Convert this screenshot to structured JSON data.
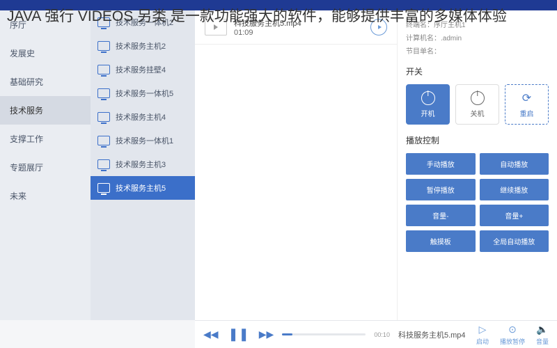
{
  "overlay": "JAVA 强行 VIDEOS 另类 是一款功能强大的软件，能够提供丰富的多媒体体验",
  "nav": {
    "items": [
      {
        "label": "序厅"
      },
      {
        "label": "发展史"
      },
      {
        "label": "基础研究"
      },
      {
        "label": "技术服务"
      },
      {
        "label": "支撑工作"
      },
      {
        "label": "专题展厅"
      },
      {
        "label": "未来"
      }
    ],
    "active": 3
  },
  "hosts": {
    "items": [
      {
        "label": "技术服务一体机2"
      },
      {
        "label": "技术服务主机2"
      },
      {
        "label": "技术服务挂壁4"
      },
      {
        "label": "技术服务一体机5"
      },
      {
        "label": "技术服务主机4"
      },
      {
        "label": "技术服务一体机1"
      },
      {
        "label": "技术服务主机3"
      },
      {
        "label": "技术服务主机5"
      }
    ],
    "active": 7
  },
  "video": {
    "title": "科技服务主机5.mp4",
    "duration": "01:09"
  },
  "meta": {
    "terminal_label": "终端名：",
    "terminal_value": "序厅主机1",
    "computer_label": "计算机名：",
    "computer_value": ".admin",
    "program_label": "节目单名："
  },
  "power": {
    "section": "开关",
    "on": "开机",
    "off": "关机",
    "restart": "重启"
  },
  "playback": {
    "section": "播放控制",
    "buttons": [
      "手动播放",
      "自动播放",
      "暂停播放",
      "继续播放",
      "音量-",
      "音量+",
      "触摸板",
      "全局自动播放"
    ]
  },
  "player": {
    "time": "00:10",
    "now_playing": "科技服务主机5.mp4",
    "actions": {
      "start": "启动",
      "pause": "播放暂停",
      "volume": "音量"
    }
  }
}
